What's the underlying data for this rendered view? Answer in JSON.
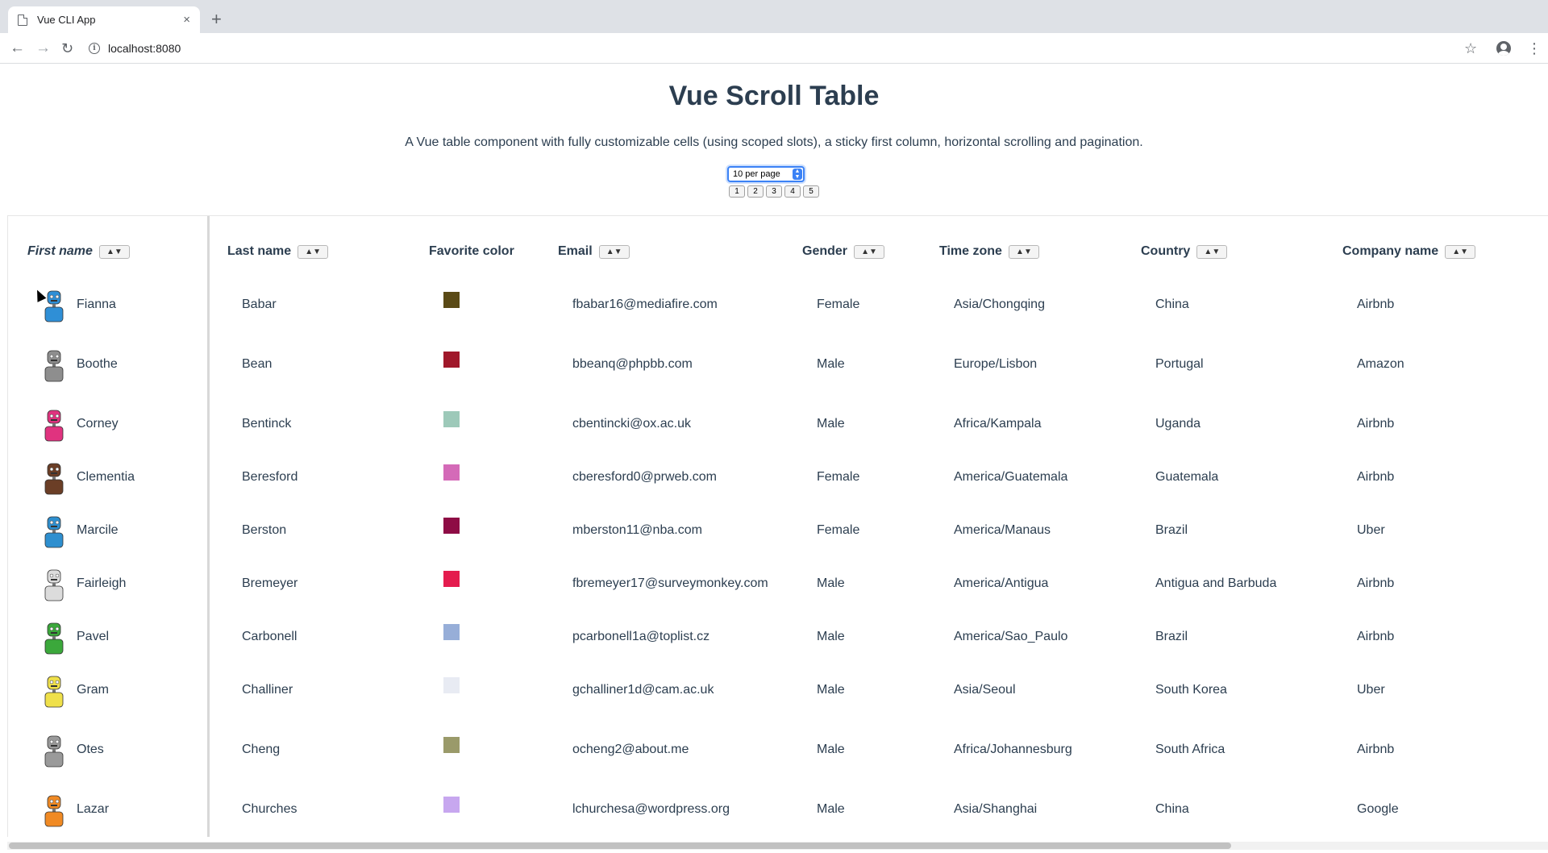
{
  "browser": {
    "tab_title": "Vue CLI App",
    "tab_close": "×",
    "new_tab": "+",
    "url": "localhost:8080"
  },
  "page": {
    "title": "Vue Scroll Table",
    "description": "A Vue table component with fully customizable cells (using scoped slots), a sticky first column, horizontal scrolling and pagination.",
    "per_page": "10 per page",
    "pages": [
      "1",
      "2",
      "3",
      "4",
      "5"
    ]
  },
  "columns": {
    "first_name": "First name",
    "last_name": "Last name",
    "favorite_color": "Favorite color",
    "email": "Email",
    "gender": "Gender",
    "time_zone": "Time zone",
    "country": "Country",
    "company_name": "Company name",
    "sort": "▲▼"
  },
  "rows": [
    {
      "first": "Fianna",
      "last": "Babar",
      "color": "#5a4a16",
      "email": "fbabar16@mediafire.com",
      "gender": "Female",
      "tz": "Asia/Chongqing",
      "country": "China",
      "company": "Airbnb",
      "avatar_color": "#2f8fd6"
    },
    {
      "first": "Boothe",
      "last": "Bean",
      "color": "#a0182a",
      "email": "bbeanq@phpbb.com",
      "gender": "Male",
      "tz": "Europe/Lisbon",
      "country": "Portugal",
      "company": "Amazon",
      "avatar_color": "#8e8e8e"
    },
    {
      "first": "Corney",
      "last": "Bentinck",
      "color": "#9dc9b9",
      "email": "cbentincki@ox.ac.uk",
      "gender": "Male",
      "tz": "Africa/Kampala",
      "country": "Uganda",
      "company": "Airbnb",
      "avatar_color": "#e0337f"
    },
    {
      "first": "Clementia",
      "last": "Beresford",
      "color": "#d46ab8",
      "email": "cberesford0@prweb.com",
      "gender": "Female",
      "tz": "America/Guatemala",
      "country": "Guatemala",
      "company": "Airbnb",
      "avatar_color": "#6b3e26"
    },
    {
      "first": "Marcile",
      "last": "Berston",
      "color": "#8e0c45",
      "email": "mberston11@nba.com",
      "gender": "Female",
      "tz": "America/Manaus",
      "country": "Brazil",
      "company": "Uber",
      "avatar_color": "#2e8fcf"
    },
    {
      "first": "Fairleigh",
      "last": "Bremeyer",
      "color": "#e41c4e",
      "email": "fbremeyer17@surveymonkey.com",
      "gender": "Male",
      "tz": "America/Antigua",
      "country": "Antigua and Barbuda",
      "company": "Airbnb",
      "avatar_color": "#dcdcdc"
    },
    {
      "first": "Pavel",
      "last": "Carbonell",
      "color": "#97aed8",
      "email": "pcarbonell1a@toplist.cz",
      "gender": "Male",
      "tz": "America/Sao_Paulo",
      "country": "Brazil",
      "company": "Airbnb",
      "avatar_color": "#3ba83b"
    },
    {
      "first": "Gram",
      "last": "Challiner",
      "color": "#e8ebf3",
      "email": "gchalliner1d@cam.ac.uk",
      "gender": "Male",
      "tz": "Asia/Seoul",
      "country": "South Korea",
      "company": "Uber",
      "avatar_color": "#efe04a"
    },
    {
      "first": "Otes",
      "last": "Cheng",
      "color": "#9a9a6a",
      "email": "ocheng2@about.me",
      "gender": "Male",
      "tz": "Africa/Johannesburg",
      "country": "South Africa",
      "company": "Airbnb",
      "avatar_color": "#9a9a9a"
    },
    {
      "first": "Lazar",
      "last": "Churches",
      "color": "#c7a7ef",
      "email": "lchurchesa@wordpress.org",
      "gender": "Male",
      "tz": "Asia/Shanghai",
      "country": "China",
      "company": "Google",
      "avatar_color": "#f08a24"
    }
  ]
}
